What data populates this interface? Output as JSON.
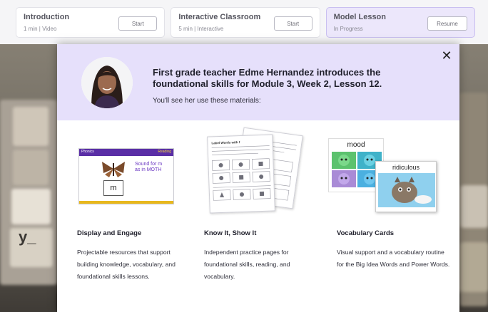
{
  "modules": [
    {
      "title": "Introduction",
      "meta": "1 min | Video",
      "button": "Start"
    },
    {
      "title": "Interactive Classroom",
      "meta": "5 min | Interactive",
      "button": "Start"
    },
    {
      "title": "Model Lesson",
      "meta": "In Progress",
      "button": "Resume"
    }
  ],
  "modal": {
    "heading": "First grade teacher Edme Hernandez introduces the foundational skills for Module 3, Week 2, Lesson 12.",
    "subheading": "You'll see her use these materials:",
    "close_icon": "close-icon"
  },
  "materials": [
    {
      "title": "Display and Engage",
      "description": "Projectable resources that support building knowledge, vocabulary, and foundational skills lessons."
    },
    {
      "title": "Know It, Show It",
      "description": "Independent practice pages for foundational skills, reading, and vocabulary."
    },
    {
      "title": "Vocabulary Cards",
      "description": "Visual support and a vocabulary routine for the Big Idea Words and Power Words."
    }
  ],
  "thumbnail": {
    "left_tag": "Phonics",
    "right_tag": "Reading",
    "note_line1": "Sound for m",
    "note_line2": "as in MOTH",
    "letter": "m"
  },
  "worksheet_title": "Label Words with f",
  "vocab_words": [
    "mood",
    "ridiculous"
  ],
  "background_labels": [
    "y_"
  ],
  "colors": {
    "header_bg": "#e6e0fb",
    "accent_purple": "#5a2ea6",
    "active_card": "#ece7fb"
  }
}
